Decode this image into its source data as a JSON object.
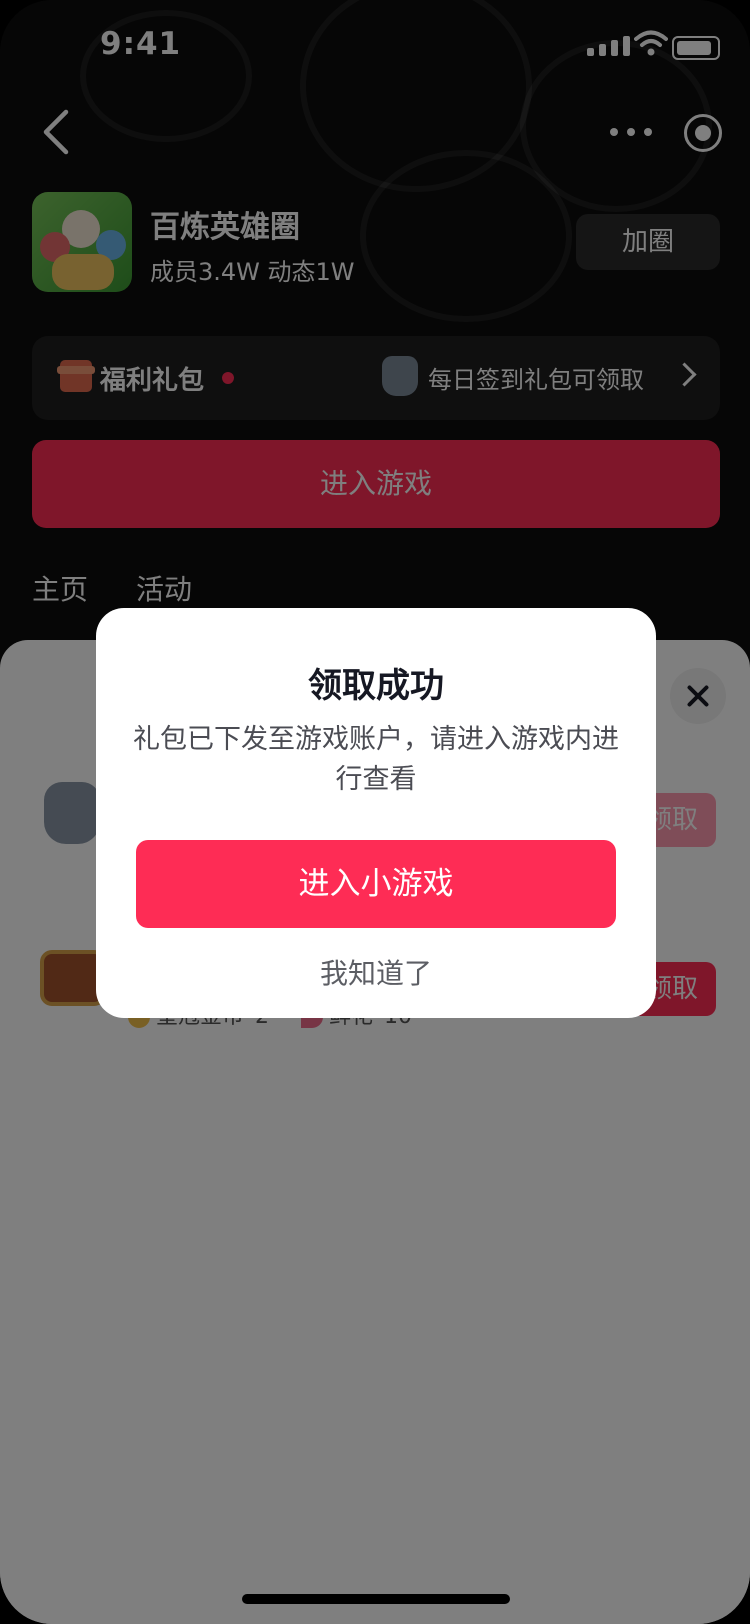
{
  "status_bar": {
    "time": "9:41"
  },
  "circle": {
    "name": "百炼英雄圈",
    "meta": "成员3.4W  动态1W",
    "join_label": "加圈"
  },
  "gift_bar": {
    "label": "福利礼包",
    "hint": "每日签到礼包可领取"
  },
  "enter_game_label": "进入游戏",
  "tabs": [
    {
      "label": "主页"
    },
    {
      "label": "活动"
    }
  ],
  "sheet": {
    "items": [
      {
        "claim_label": "领取"
      },
      {
        "claim_label": "领取",
        "rewards": [
          "皇冠金币*2",
          "鲜花*10"
        ]
      }
    ]
  },
  "modal": {
    "title": "领取成功",
    "message": "礼包已下发至游戏账户，请进入游戏内进行查看",
    "primary_label": "进入小游戏",
    "secondary_label": "我知道了"
  },
  "colors": {
    "accent": "#FE2C55",
    "text_primary": "#161823"
  }
}
